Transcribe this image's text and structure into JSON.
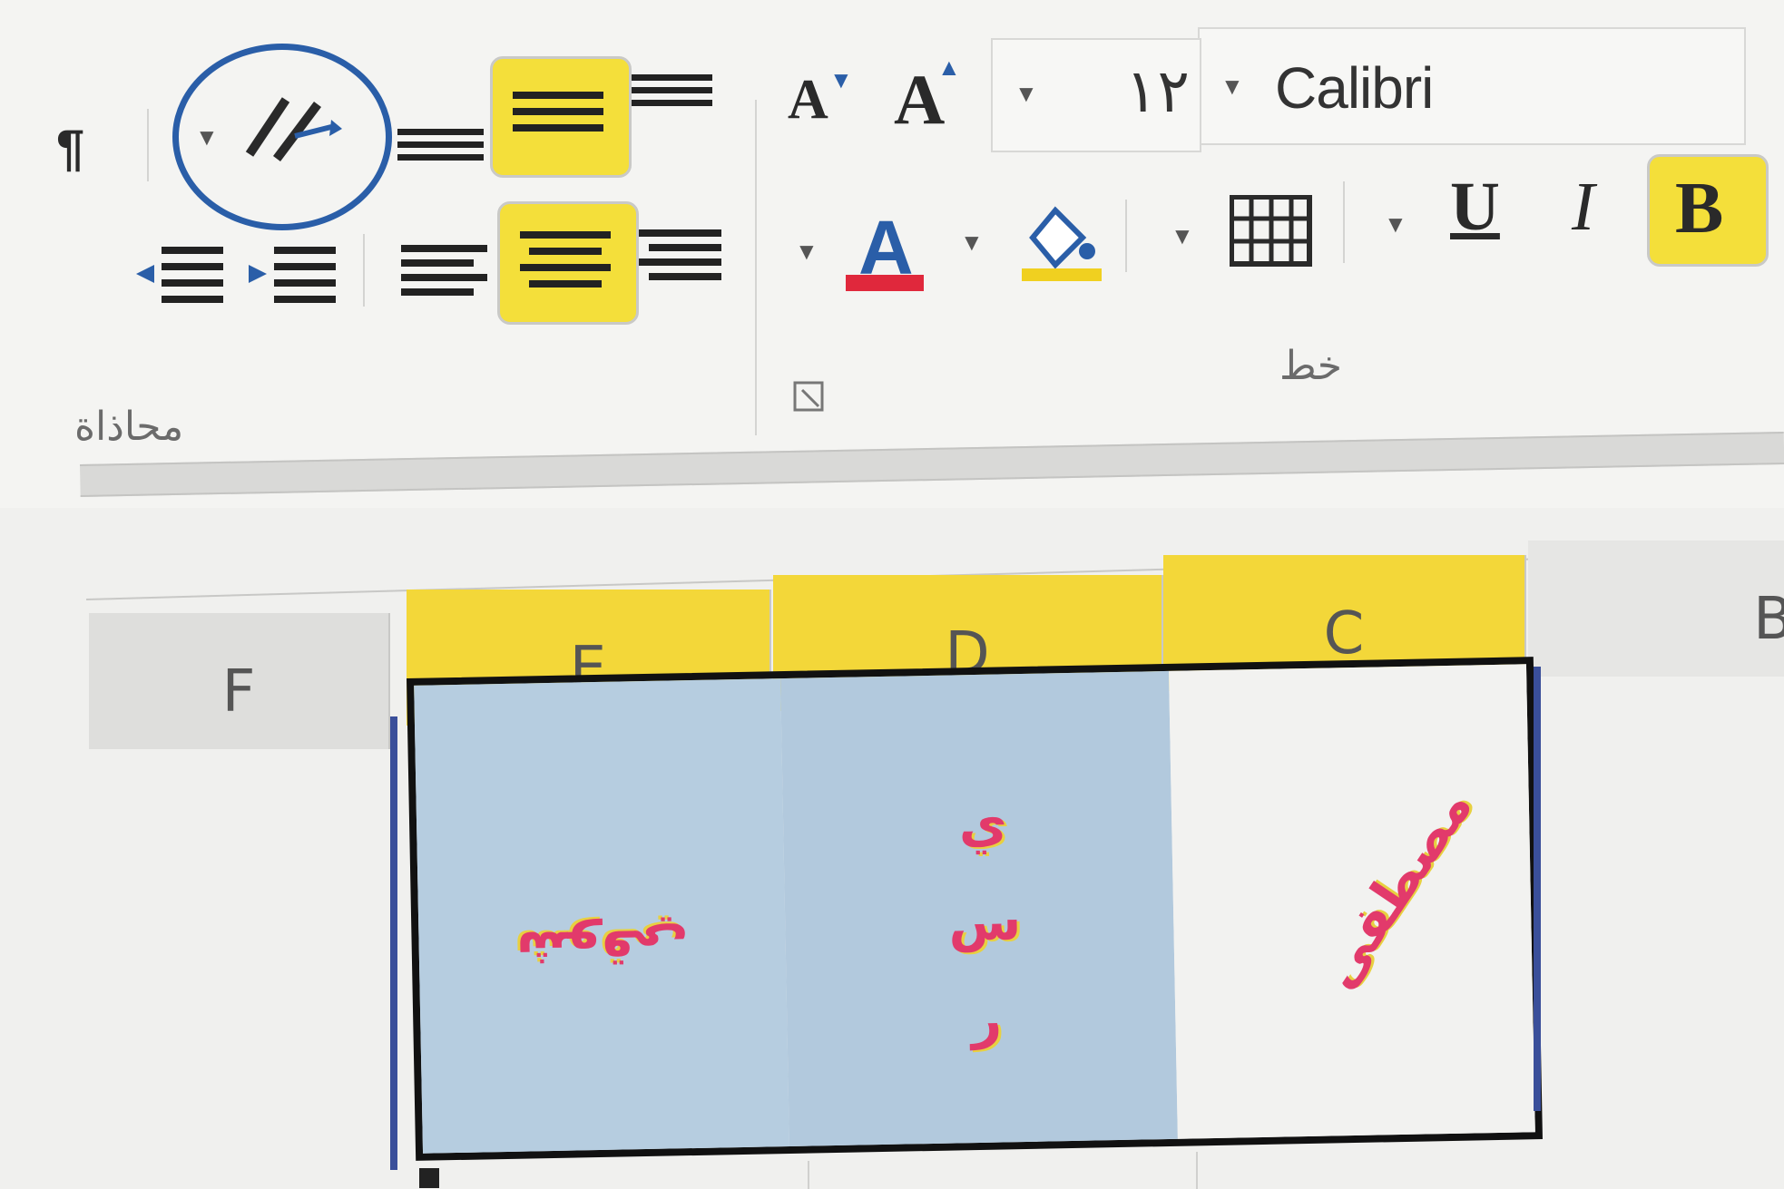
{
  "ribbon": {
    "font_group": {
      "label": "خط",
      "font_name": "Calibri",
      "font_size": "١٢",
      "buttons": {
        "bold": "B",
        "italic": "I",
        "underline": "U",
        "font_color_letter": "A",
        "increase_font": "A",
        "decrease_font": "A"
      }
    },
    "alignment_group": {
      "label": "محاذاة"
    },
    "colors": {
      "highlight": "#f3d739",
      "circle": "#2a5ea8",
      "font_color_bar": "#e0283c",
      "fill_color_bar": "#f0d020"
    }
  },
  "sheet": {
    "columns": [
      "F",
      "E",
      "D",
      "C",
      "B"
    ],
    "selected_columns": [
      "E",
      "D",
      "C"
    ],
    "cells": {
      "E": "شوقي",
      "D": "ي\nس\nر",
      "C": "مصطفى"
    },
    "colors": {
      "selection_fill": "#b6cde0",
      "text": "#e23a6b"
    }
  }
}
